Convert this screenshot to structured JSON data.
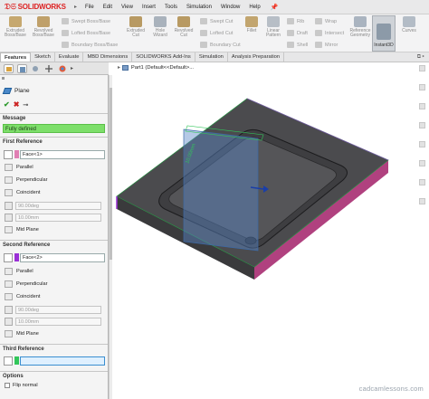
{
  "app": {
    "brand": "SOLIDWORKS",
    "menu": [
      "File",
      "Edit",
      "View",
      "Insert",
      "Tools",
      "Simulation",
      "Window",
      "Help"
    ]
  },
  "ribbon": {
    "extruded_boss": "Extruded\nBoss/Base",
    "revolved_boss": "Revolved\nBoss/Base",
    "swept_boss": "Swept Boss/Base",
    "lofted_boss": "Lofted Boss/Base",
    "boundary_boss": "Boundary Boss/Base",
    "extruded_cut": "Extruded\nCut",
    "hole_wizard": "Hole\nWizard",
    "revolved_cut": "Revolved\nCut",
    "swept_cut": "Swept Cut",
    "lofted_cut": "Lofted Cut",
    "boundary_cut": "Boundary Cut",
    "fillet": "Fillet",
    "linear_pattern": "Linear\nPattern",
    "rib": "Rib",
    "draft": "Draft",
    "shell": "Shell",
    "wrap": "Wrap",
    "intersect": "Intersect",
    "mirror": "Mirror",
    "reference_geometry": "Reference\nGeometry",
    "curves": "Curves",
    "instant3d": "Instant3D"
  },
  "tabs": [
    "Features",
    "Sketch",
    "Evaluate",
    "MBD Dimensions",
    "SOLIDWORKS Add-Ins",
    "Simulation",
    "Analysis Preparation"
  ],
  "tree": {
    "part": "Part1  (Default<<Default>..."
  },
  "panel": {
    "title": "Plane",
    "message_header": "Message",
    "message": "Fully defined",
    "first_ref_header": "First Reference",
    "first_ref_value": "Face<1>",
    "second_ref_header": "Second Reference",
    "second_ref_value": "Face<2>",
    "third_ref_header": "Third Reference",
    "third_ref_value": "",
    "options": [
      "Parallel",
      "Perpendicular",
      "Coincident"
    ],
    "angle": "90.00deg",
    "distance": "10.00mm",
    "mid_plane": "Mid Plane",
    "options_header": "Options",
    "flip_normal": "Flip normal"
  },
  "watermark": "cadcamlessons.com",
  "colors": {
    "accent": "#d22222",
    "message_green": "#7ddf6a",
    "face1": "#e07fb3",
    "face2": "#9a2fd6",
    "face3": "#32c65a",
    "plane": "#5a87c8"
  }
}
